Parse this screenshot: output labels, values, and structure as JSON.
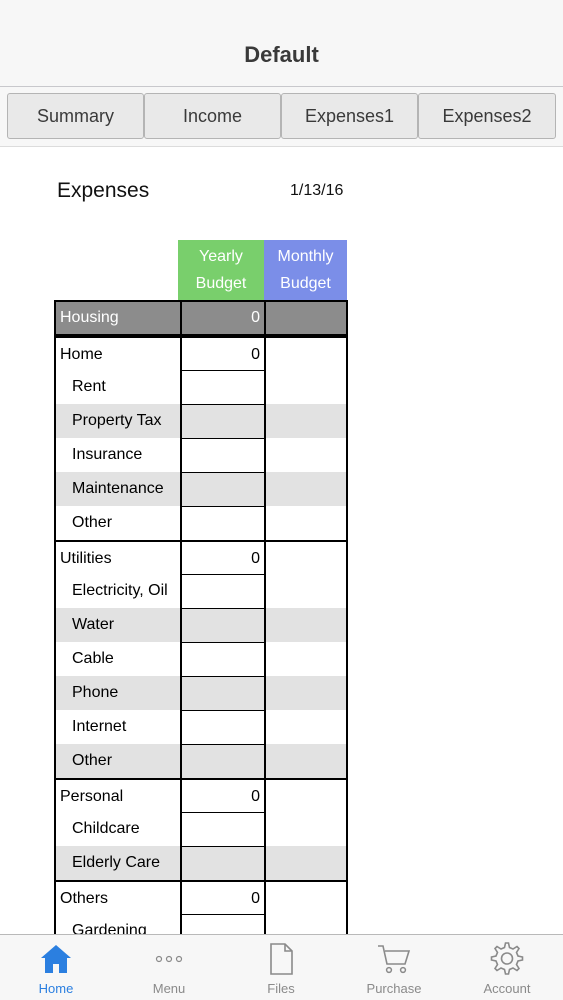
{
  "header": {
    "title": "Default"
  },
  "tabs": [
    {
      "label": "Summary"
    },
    {
      "label": "Income"
    },
    {
      "label": "Expenses1"
    },
    {
      "label": "Expenses2"
    }
  ],
  "sheet": {
    "title": "Expenses",
    "date": "1/13/16",
    "columns": {
      "yearly": [
        "Yearly",
        "Budget"
      ],
      "monthly": [
        "Monthly",
        "Budget"
      ]
    },
    "rows": [
      {
        "label": "Housing",
        "yearly": "0",
        "monthly": "",
        "kind": "housing"
      },
      {
        "label": "Home",
        "yearly": "0",
        "monthly": "",
        "kind": "group"
      },
      {
        "label": "Rent",
        "yearly": "",
        "monthly": "",
        "kind": "sub"
      },
      {
        "label": "Property Tax",
        "yearly": "",
        "monthly": "",
        "kind": "sub-shade"
      },
      {
        "label": "Insurance",
        "yearly": "",
        "monthly": "",
        "kind": "sub"
      },
      {
        "label": "Maintenance",
        "yearly": "",
        "monthly": "",
        "kind": "sub-shade"
      },
      {
        "label": "Other",
        "yearly": "",
        "monthly": "",
        "kind": "sub"
      },
      {
        "label": "Utilities",
        "yearly": "0",
        "monthly": "",
        "kind": "group"
      },
      {
        "label": "Electricity, Oil",
        "yearly": "",
        "monthly": "",
        "kind": "sub"
      },
      {
        "label": "Water",
        "yearly": "",
        "monthly": "",
        "kind": "sub-shade"
      },
      {
        "label": "Cable",
        "yearly": "",
        "monthly": "",
        "kind": "sub"
      },
      {
        "label": "Phone",
        "yearly": "",
        "monthly": "",
        "kind": "sub-shade"
      },
      {
        "label": "Internet",
        "yearly": "",
        "monthly": "",
        "kind": "sub"
      },
      {
        "label": "Other",
        "yearly": "",
        "monthly": "",
        "kind": "sub-shade"
      },
      {
        "label": "Personal",
        "yearly": "0",
        "monthly": "",
        "kind": "group"
      },
      {
        "label": "Childcare",
        "yearly": "",
        "monthly": "",
        "kind": "sub"
      },
      {
        "label": "Elderly Care",
        "yearly": "",
        "monthly": "",
        "kind": "sub-shade"
      },
      {
        "label": "Others",
        "yearly": "0",
        "monthly": "",
        "kind": "group"
      },
      {
        "label": "Gardening",
        "yearly": "",
        "monthly": "",
        "kind": "sub"
      }
    ]
  },
  "tabbar": [
    {
      "label": "Home",
      "icon": "home-icon",
      "active": true
    },
    {
      "label": "Menu",
      "icon": "more-icon",
      "active": false
    },
    {
      "label": "Files",
      "icon": "file-icon",
      "active": false
    },
    {
      "label": "Purchase",
      "icon": "cart-icon",
      "active": false
    },
    {
      "label": "Account",
      "icon": "gear-icon",
      "active": false
    }
  ],
  "colors": {
    "accent": "#2b7fe0",
    "yearly_header": "#79cf6c",
    "monthly_header": "#7b8ee8",
    "housing_row": "#8c8c8c",
    "shade_row": "#e2e2e2"
  }
}
